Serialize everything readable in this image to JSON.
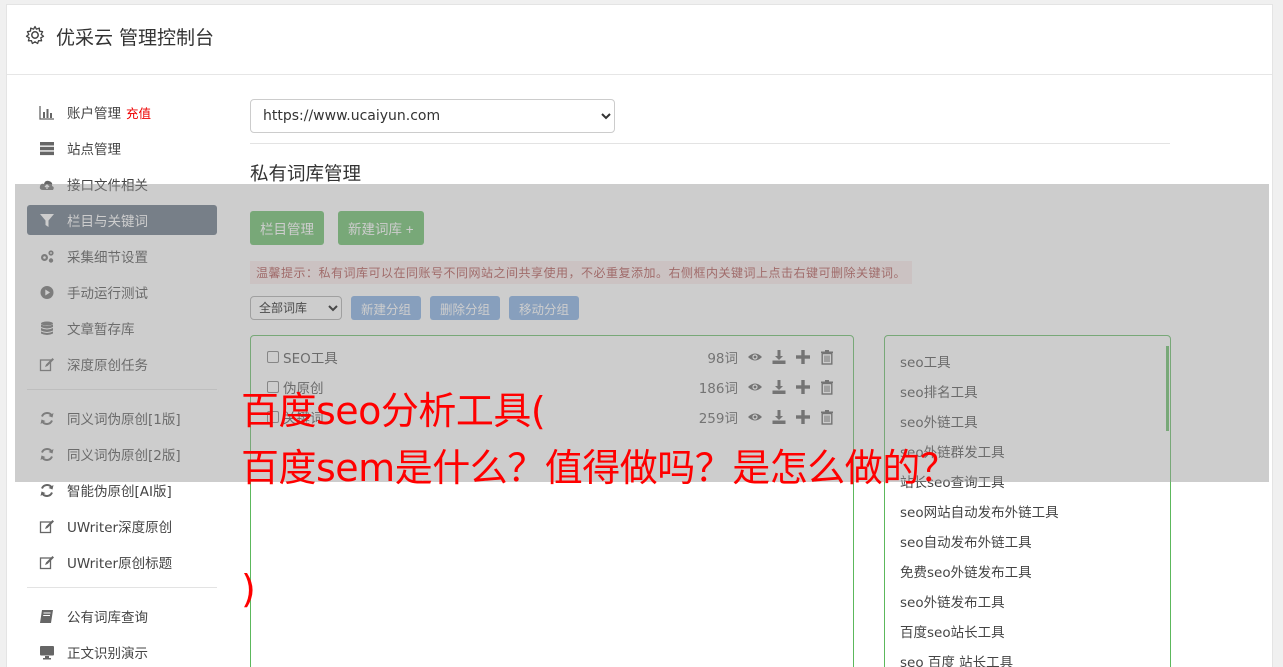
{
  "header": {
    "title": "优采云 管理控制台"
  },
  "sidebar": {
    "group1": [
      {
        "label": "账户管理",
        "badge": "充值",
        "icon": "bar-chart-icon"
      },
      {
        "label": "站点管理",
        "icon": "server-icon"
      },
      {
        "label": "接口文件相关",
        "icon": "cloud-upload-icon"
      },
      {
        "label": "栏目与关键词",
        "icon": "filter-icon",
        "active": true
      },
      {
        "label": "采集细节设置",
        "icon": "gears-icon"
      },
      {
        "label": "手动运行测试",
        "icon": "play-circle-icon"
      },
      {
        "label": "文章暂存库",
        "icon": "database-icon"
      },
      {
        "label": "深度原创任务",
        "icon": "edit-icon"
      }
    ],
    "group2": [
      {
        "label": "同义词伪原创[1版]",
        "icon": "refresh-icon"
      },
      {
        "label": "同义词伪原创[2版]",
        "icon": "refresh-icon"
      },
      {
        "label": "智能伪原创[AI版]",
        "icon": "refresh-icon"
      },
      {
        "label": "UWriter深度原创",
        "icon": "edit-icon"
      },
      {
        "label": "UWriter原创标题",
        "icon": "edit-icon"
      }
    ],
    "group3": [
      {
        "label": "公有词库查询",
        "icon": "book-icon"
      },
      {
        "label": "正文识别演示",
        "icon": "monitor-icon"
      }
    ]
  },
  "main": {
    "site_url": "https://www.ucaiyun.com",
    "section_title": "私有词库管理",
    "btn_column": "栏目管理",
    "btn_new_lib": "新建词库 +",
    "tip": "温馨提示：私有词库可以在同账号不同网站之间共享使用，不必重复添加。右侧框内关键词上点击右键可删除关键词。",
    "lib_filter": "全部词库",
    "btn_new_group": "新建分组",
    "btn_del_group": "删除分组",
    "btn_move_group": "移动分组",
    "libraries": [
      {
        "name": "SEO工具",
        "count": "98词"
      },
      {
        "name": "伪原创",
        "count": "186词"
      },
      {
        "name": "关键词",
        "count": "259词"
      }
    ],
    "keywords": [
      "seo工具",
      "seo排名工具",
      "seo外链工具",
      "seo外链群发工具",
      "站长seo查询工具",
      "seo网站自动发布外链工具",
      "seo自动发布外链工具",
      "免费seo外链发布工具",
      "seo外链发布工具",
      "百度seo站长工具",
      "seo 百度 站长工具"
    ]
  },
  "watermark": {
    "line1": "百度seo分析工具(",
    "line2": "百度sem是什么？值得做吗？是怎么做的？",
    "line3": ")"
  },
  "colors": {
    "accent_green": "#5cb85c",
    "accent_blue": "#5bc0de",
    "active_nav": "#5b6a7c",
    "watermark": "#ff0000"
  }
}
